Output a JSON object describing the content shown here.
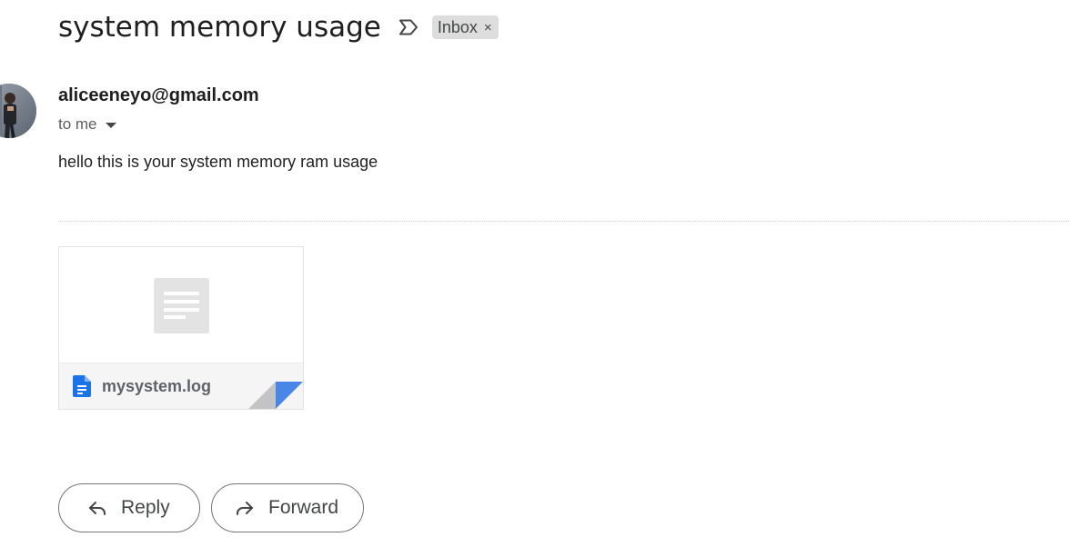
{
  "message": {
    "subject": "system memory usage",
    "labels": [
      {
        "name": "Inbox",
        "remove_glyph": "×"
      }
    ],
    "importance_icon": "label-important-outline-icon",
    "sender": {
      "email": "aliceeneyo@gmail.com",
      "recipient_summary": "to me",
      "avatar": "sender-avatar-photo"
    },
    "body": "hello this is your system memory ram usage",
    "attachments": [
      {
        "file_name": "mysystem.log",
        "file_icon": "google-docs-file-icon",
        "preview_icon": "document-placeholder-icon"
      }
    ]
  },
  "actions": {
    "reply_label": "Reply",
    "reply_icon": "reply-arrow-icon",
    "forward_label": "Forward",
    "forward_icon": "forward-arrow-icon"
  },
  "colors": {
    "chip_background": "#dddddd",
    "doc_icon_blue": "#1a73e8",
    "fold_blue": "#4285f4",
    "button_border": "#747775"
  }
}
